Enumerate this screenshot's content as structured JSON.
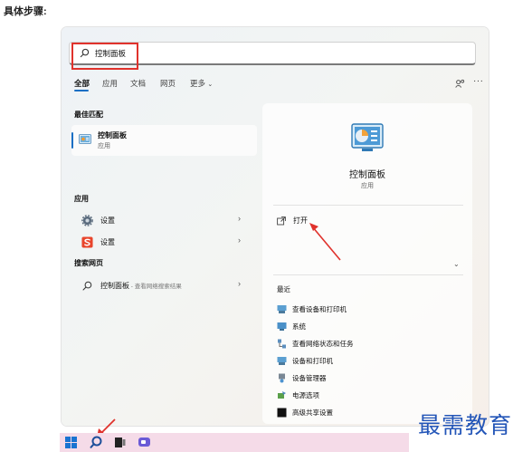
{
  "heading": "具体步骤:",
  "search": {
    "value": "控制面板"
  },
  "tabs": [
    {
      "label": "全部",
      "active": true
    },
    {
      "label": "应用",
      "active": false
    },
    {
      "label": "文档",
      "active": false
    },
    {
      "label": "网页",
      "active": false
    },
    {
      "label": "更多",
      "active": false
    }
  ],
  "tabs_more_chevron": "⌄",
  "header_icons": {
    "more": "···"
  },
  "best_match": {
    "section": "最佳匹配",
    "name": "控制面板",
    "type": "应用"
  },
  "apps": {
    "section": "应用",
    "items": [
      {
        "label": "设置",
        "icon": "gear-icon"
      },
      {
        "label": "设置",
        "icon": "s-app-icon"
      }
    ]
  },
  "web": {
    "section": "搜索网页",
    "label": "控制面板",
    "desc": " - 查看网络搜索结果"
  },
  "preview": {
    "title": "控制面板",
    "type": "应用",
    "open_label": "打开",
    "expand": "⌄",
    "recent_title": "最近",
    "recent": [
      {
        "label": "查看设备和打印机",
        "icon": "devices-printers-icon"
      },
      {
        "label": "系统",
        "icon": "system-icon"
      },
      {
        "label": "查看网络状态和任务",
        "icon": "network-icon"
      },
      {
        "label": "设备和打印机",
        "icon": "devices-printers-icon"
      },
      {
        "label": "设备管理器",
        "icon": "device-manager-icon"
      },
      {
        "label": "电源选项",
        "icon": "power-options-icon"
      },
      {
        "label": "高级共享设置",
        "icon": "sharing-icon"
      }
    ]
  },
  "chevron": "›",
  "taskbar": [
    "windows-start-icon",
    "search-icon",
    "task-view-icon",
    "chat-icon"
  ],
  "colors": {
    "accent": "#1a6fc4",
    "highlight": "#e0322c",
    "taskbar": "#f5dbe8",
    "watermark": "#2456b8"
  },
  "watermark": "最需教育"
}
